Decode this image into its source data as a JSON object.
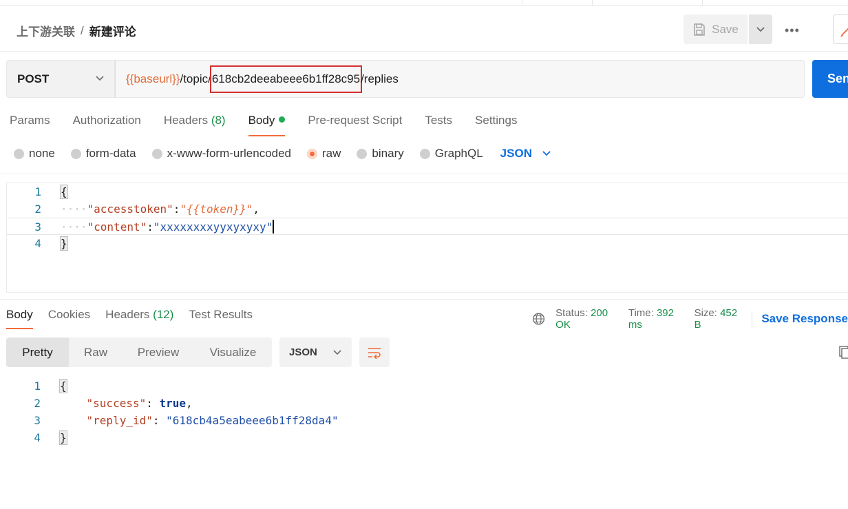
{
  "breadcrumb": {
    "parent": "上下游关联",
    "separator": "/",
    "current": "新建评论"
  },
  "toolbar": {
    "save_label": "Save",
    "more_label": "•••"
  },
  "request": {
    "method": "POST",
    "url_var": "{{baseurl}}",
    "url_prefix": "/topic/",
    "url_highlight": "618cb2deeabeee6b1ff28c95",
    "url_suffix": "/replies",
    "send_label": "Send"
  },
  "request_tabs": [
    {
      "label": "Params"
    },
    {
      "label": "Authorization"
    },
    {
      "label": "Headers",
      "count": "(8)"
    },
    {
      "label": "Body"
    },
    {
      "label": "Pre-request Script"
    },
    {
      "label": "Tests"
    },
    {
      "label": "Settings"
    }
  ],
  "body_types": [
    "none",
    "form-data",
    "x-www-form-urlencoded",
    "raw",
    "binary",
    "GraphQL"
  ],
  "body_format": "JSON",
  "request_body": {
    "line_numbers": [
      "1",
      "2",
      "3",
      "4"
    ],
    "open_brace": "{",
    "close_brace": "}",
    "accesstoken_key": "\"accesstoken\"",
    "accesstoken_value": "\"{{token}}\"",
    "content_key": "\"content\"",
    "content_value": "\"xxxxxxxxyyxyxyxy\""
  },
  "response_tabs": [
    {
      "label": "Body"
    },
    {
      "label": "Cookies"
    },
    {
      "label": "Headers",
      "count": "(12)"
    },
    {
      "label": "Test Results"
    }
  ],
  "response_meta": {
    "status_label": "Status:",
    "status_value": "200 OK",
    "time_label": "Time:",
    "time_value": "392 ms",
    "size_label": "Size:",
    "size_value": "452 B",
    "save_response": "Save Response"
  },
  "view_tabs": [
    "Pretty",
    "Raw",
    "Preview",
    "Visualize"
  ],
  "response_format": "JSON",
  "response_body": {
    "line_numbers": [
      "1",
      "2",
      "3",
      "4"
    ],
    "open_brace": "{",
    "close_brace": "}",
    "success_key": "\"success\"",
    "success_value": "true",
    "reply_key": "\"reply_id\"",
    "reply_value": "\"618cb4a5eabeee6b1ff28da4\""
  },
  "colors": {
    "accent": "#f26b3a",
    "primary": "#0f6fde",
    "success": "#1a8f4a",
    "highlight_box": "#d32f2f"
  }
}
